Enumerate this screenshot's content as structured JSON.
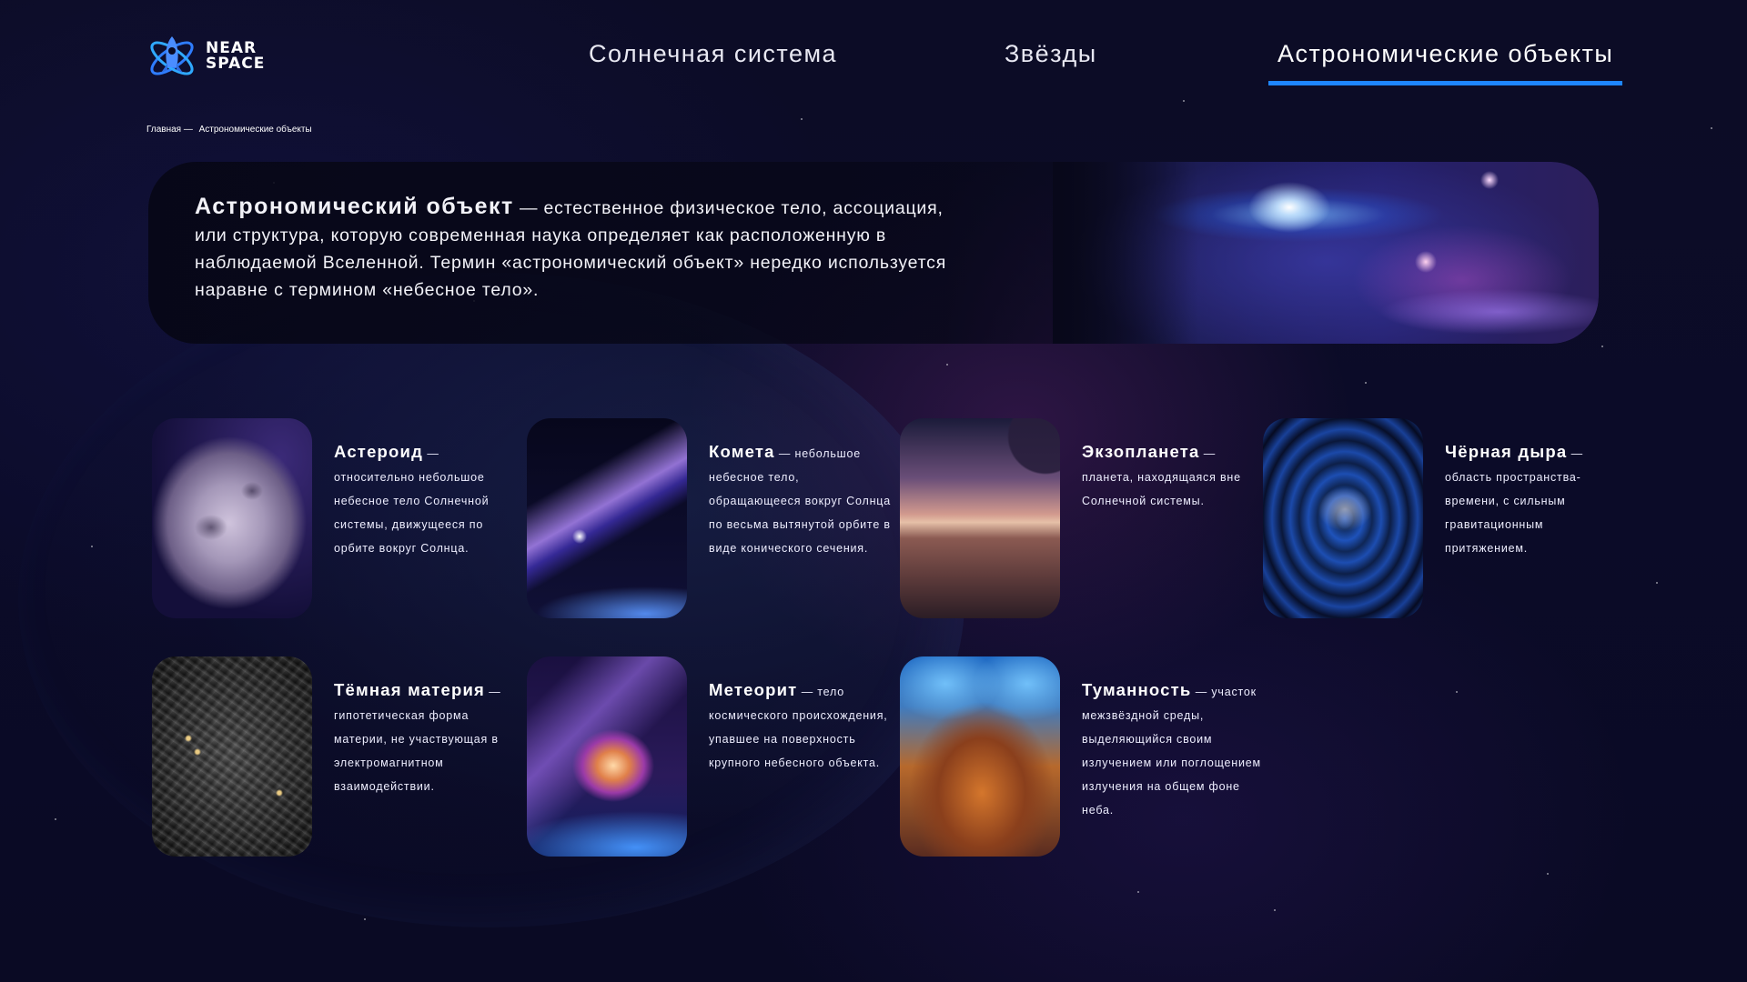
{
  "logo": {
    "line1": "NEAR",
    "line2": "SPACE"
  },
  "nav": [
    {
      "label": "Солнечная система"
    },
    {
      "label": "Звёзды"
    },
    {
      "label": "Астрономические объекты"
    }
  ],
  "breadcrumb": {
    "home": "Главная",
    "separator": "—",
    "current": "Астрономические объекты"
  },
  "hero": {
    "term": "Астрономический объект",
    "definition": " — естественное физическое тело, ассоциация, или структура, которую современная наука определяет как расположенную в наблюдаемой Вселенной. Термин «астрономический объект» нередко используется наравне с термином «небесное тело»."
  },
  "cards": [
    {
      "title": "Астероид",
      "text": " — относительно небольшое небесное тело Солнечной системы, движущееся по орбите вокруг Солнца."
    },
    {
      "title": "Комета",
      "text": " — небольшое небесное тело, обращающееся вокруг Солнца по весьма вытянутой орбите в виде конического сечения."
    },
    {
      "title": "Экзопланета",
      "text": " — планета, находящаяся вне Солнечной системы."
    },
    {
      "title": "Чёрная дыра",
      "text": " — область пространства-времени, с сильным гравитационным притяжением."
    },
    {
      "title": "Тёмная материя",
      "text": " — гипотетическая форма материи, не участвующая в электромагнитном взаимодействии."
    },
    {
      "title": "Метеорит",
      "text": " — тело космического происхождения, упавшее на поверхность крупного небесного объекта."
    },
    {
      "title": "Туманность",
      "text": " — участок межзвёздной среды, выделяющийся своим излучением или поглощением излучения на общем фоне неба."
    }
  ],
  "colors": {
    "accent": "#1e86ff",
    "background": "#0a0a22"
  }
}
